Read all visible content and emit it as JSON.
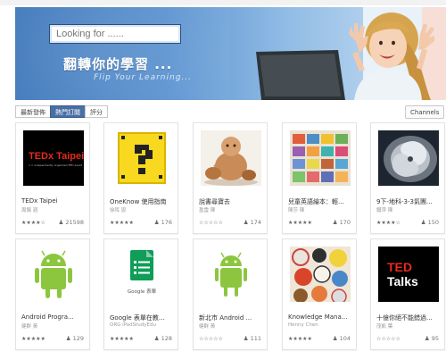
{
  "search": {
    "placeholder": "Looking for ......"
  },
  "hero": {
    "title": "翻轉你的學習 ...",
    "subtitle": "Flip Your Learning..."
  },
  "tabs": [
    "最新發佈",
    "熱門訂閱",
    "評分"
  ],
  "active_tab": 1,
  "channels_label": "Channels",
  "cards": [
    {
      "title": "TEDx Taipei",
      "author": "周錫 週",
      "rating": "★★★★☆",
      "users": "21598",
      "thumb_icon": "tedx-taipei-logo"
    },
    {
      "title": "OneKnow 使用指南",
      "author": "徐晖 恩",
      "rating": "★★★★★",
      "users": "176",
      "thumb_icon": "question-block-icon"
    },
    {
      "title": "說書尋寶去",
      "author": "盈雲 陳",
      "rating": "☆☆☆☆☆",
      "users": "174",
      "thumb_icon": "clay-figures-image"
    },
    {
      "title": "兒童英語繪本：輕...",
      "author": "陳莎 陳",
      "rating": "★★★★★",
      "users": "170",
      "thumb_icon": "picture-books-image"
    },
    {
      "title": "9下-地科-3-3氣團...",
      "author": "鐵萍 陳",
      "rating": "★★★★☆",
      "users": "150",
      "thumb_icon": "typhoon-satellite-image"
    },
    {
      "title": "Android Progra...",
      "author": "健群 黃",
      "rating": "★★★★★",
      "users": "129",
      "thumb_icon": "android-robot-icon"
    },
    {
      "title": "Google 表單在教...",
      "author": "ORG iPadStudyEdu",
      "rating": "★★★★★",
      "users": "128",
      "thumb_icon": "google-forms-icon"
    },
    {
      "title": "新北市 Android ...",
      "author": "健群 黃",
      "rating": "☆☆☆☆☆",
      "users": "111",
      "thumb_icon": "android-robot-icon"
    },
    {
      "title": "Knowledge Mana...",
      "author": "Henny Chen",
      "rating": "★★★★★",
      "users": "104",
      "thumb_icon": "badges-collage-image"
    },
    {
      "title": "十億你絕不能錯過...",
      "author": "茂凱 葉",
      "rating": "☆☆☆☆☆",
      "users": "95",
      "thumb_icon": "ted-talks-logo"
    }
  ],
  "thumb_text": {
    "tedx": "TEDx Taipei",
    "tedx_tag": "x = independently organized TED event",
    "ted": "TED",
    "talks": "Talks",
    "google_forms": "Google 表單"
  },
  "colors": {
    "tab_active": "#4a6fa5",
    "hero_blue": "#3f78bb",
    "ted_red": "#e62b1e"
  }
}
